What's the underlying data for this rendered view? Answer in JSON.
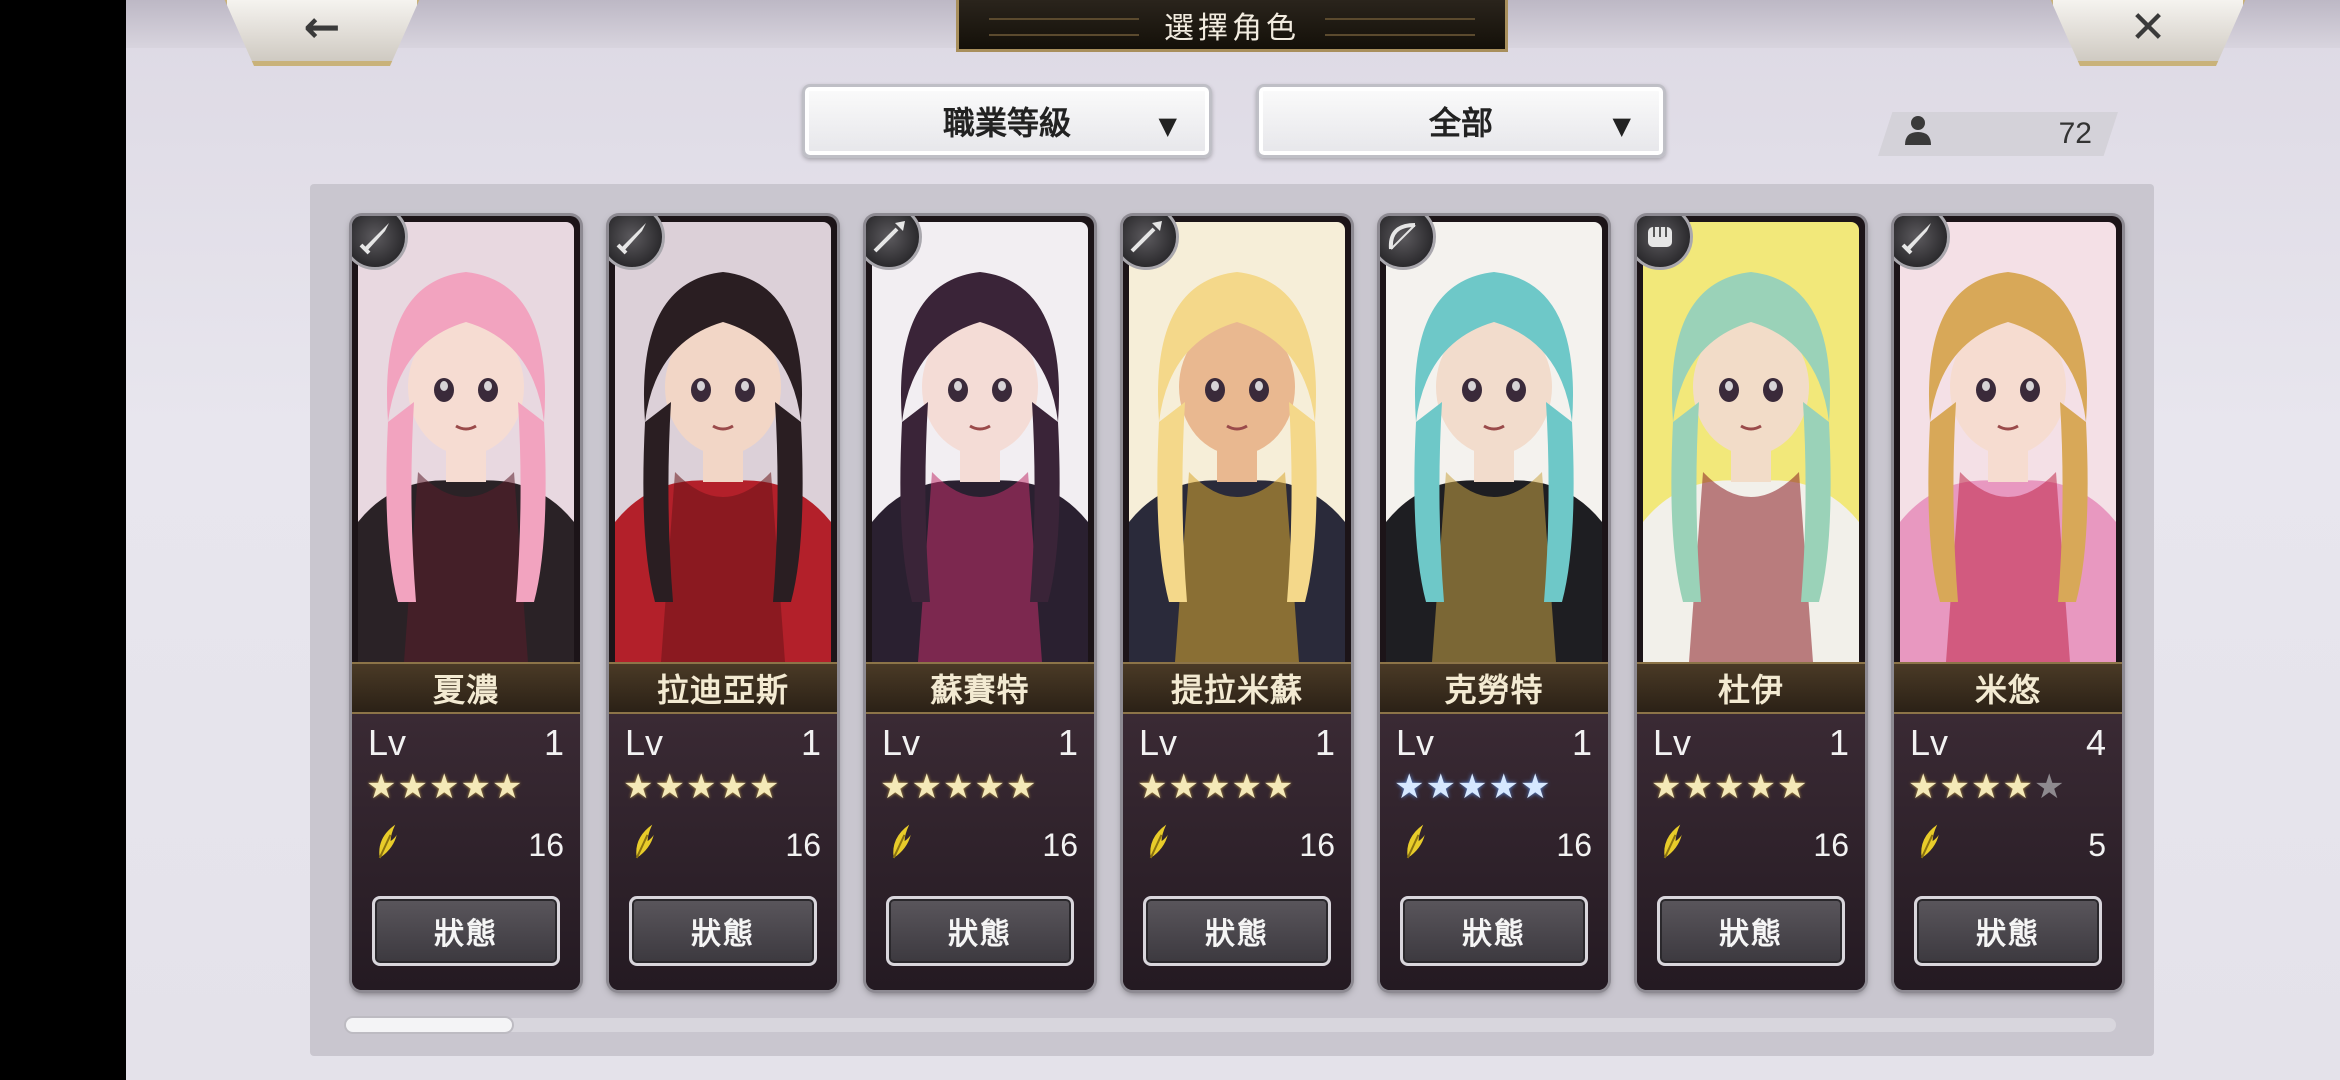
{
  "header": {
    "title": "選擇角色",
    "back_glyph": "←",
    "close_glyph": "✕"
  },
  "filters": {
    "sort_label": "職業等級",
    "filter_label": "全部",
    "arrow_glyph": "▼"
  },
  "roster_count": "72",
  "level_label": "Lv",
  "status_label": "狀態",
  "characters": [
    {
      "name": "夏濃",
      "level": "1",
      "rarity": 5,
      "max_rarity": 5,
      "star_color": "gold",
      "feather": "16",
      "weapon": "sword-icon",
      "hair": "#f2a3bf",
      "skin": "#f6dcd2",
      "outfit": "#2a2226",
      "bg": "#e8d8e0",
      "accent": "#5a1e2a"
    },
    {
      "name": "拉迪亞斯",
      "level": "1",
      "rarity": 5,
      "max_rarity": 5,
      "star_color": "gold",
      "feather": "16",
      "weapon": "sword-icon",
      "hair": "#2a1e22",
      "skin": "#f2d6c6",
      "outfit": "#b3202a",
      "bg": "#dcd0d8",
      "accent": "#6a1418"
    },
    {
      "name": "蘇賽特",
      "level": "1",
      "rarity": 5,
      "max_rarity": 5,
      "star_color": "gold",
      "feather": "16",
      "weapon": "spear-icon",
      "hair": "#3a2438",
      "skin": "#f4dcd6",
      "outfit": "#2a2030",
      "bg": "#f2eef2",
      "accent": "#c0306a"
    },
    {
      "name": "提拉米蘇",
      "level": "1",
      "rarity": 5,
      "max_rarity": 5,
      "star_color": "gold",
      "feather": "16",
      "weapon": "spear-icon",
      "hair": "#f4d88a",
      "skin": "#e9b890",
      "outfit": "#2a2a3a",
      "bg": "#f6eed8",
      "accent": "#d8a830"
    },
    {
      "name": "克勞特",
      "level": "1",
      "rarity": 5,
      "max_rarity": 5,
      "star_color": "blue",
      "feather": "16",
      "weapon": "bow-icon",
      "hair": "#6ec8c8",
      "skin": "#f2dccc",
      "outfit": "#1e1e22",
      "bg": "#f4f2ee",
      "accent": "#c9a446"
    },
    {
      "name": "杜伊",
      "level": "1",
      "rarity": 5,
      "max_rarity": 5,
      "star_color": "gold",
      "feather": "16",
      "weapon": "fist-icon",
      "hair": "#9ad2b8",
      "skin": "#f2dcc8",
      "outfit": "#f2f0ea",
      "bg": "#f2e87a",
      "accent": "#8a1e22"
    },
    {
      "name": "米悠",
      "level": "4",
      "rarity": 4,
      "max_rarity": 5,
      "star_color": "gold",
      "feather": "5",
      "weapon": "sword-icon",
      "hair": "#d8a858",
      "skin": "#f6dcd0",
      "outfit": "#e898c0",
      "bg": "#f4e0e6",
      "accent": "#c02848"
    }
  ]
}
